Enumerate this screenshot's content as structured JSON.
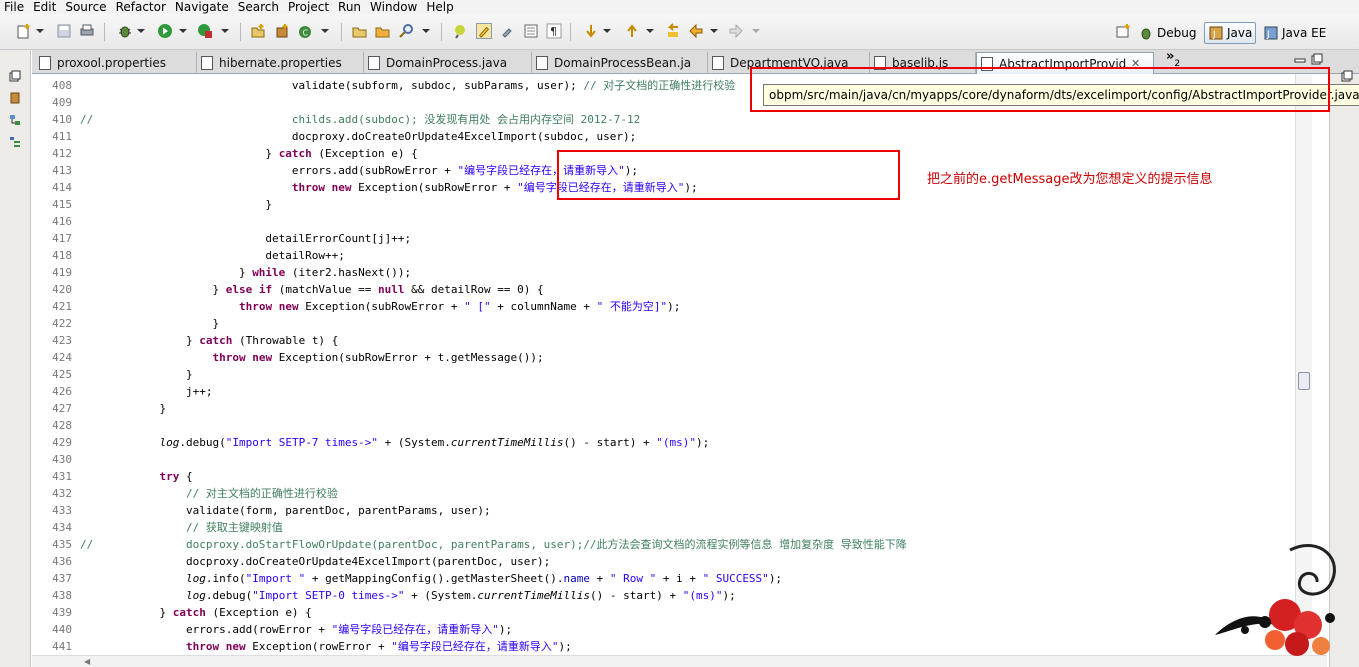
{
  "menu": [
    "File",
    "Edit",
    "Source",
    "Refactor",
    "Navigate",
    "Search",
    "Project",
    "Run",
    "Window",
    "Help"
  ],
  "perspectives": {
    "debug": "Debug",
    "java": "Java",
    "java_ee": "Java EE"
  },
  "tabs": [
    {
      "label": "proxool.properties",
      "icon": "properties-file-icon"
    },
    {
      "label": "hibernate.properties",
      "icon": "properties-file-icon"
    },
    {
      "label": "DomainProcess.java",
      "icon": "java-file-icon"
    },
    {
      "label": "DomainProcessBean.ja",
      "icon": "java-file-icon"
    },
    {
      "label": "DepartmentVO.java",
      "icon": "java-file-icon"
    },
    {
      "label": "baselib.js",
      "icon": "js-file-icon"
    },
    {
      "label": "AbstractImportProvid",
      "icon": "java-file-icon",
      "active": true
    }
  ],
  "tabs_overflow": "»",
  "tabs_overflow_count": "2",
  "tooltip": "obpm/src/main/java/cn/myapps/core/dynaform/dts/excelimport/config/AbstractImportProvider.java",
  "annotation": "把之前的e.getMessage改为您想定义的提示信息",
  "code_lines": [
    {
      "n": "408",
      "t": "                                validate(subform, subdoc, subParams, user); // 对子文档的正确性进行校验"
    },
    {
      "n": "409",
      "t": ""
    },
    {
      "n": "410",
      "t": "//                              childs.add(subdoc); 没发现有用处 会占用内存空间 2012-7-12"
    },
    {
      "n": "411",
      "t": "                                docproxy.doCreateOrUpdate4ExcelImport(subdoc, user);"
    },
    {
      "n": "412",
      "t": "                            } catch (Exception e) {"
    },
    {
      "n": "413",
      "t": "                                errors.add(subRowError + \"编号字段已经存在，请重新导入\");"
    },
    {
      "n": "414",
      "t": "                                throw new Exception(subRowError + \"编号字段已经存在，请重新导入\");"
    },
    {
      "n": "415",
      "t": "                            }"
    },
    {
      "n": "416",
      "t": ""
    },
    {
      "n": "417",
      "t": "                            detailErrorCount[j]++;"
    },
    {
      "n": "418",
      "t": "                            detailRow++;"
    },
    {
      "n": "419",
      "t": "                        } while (iter2.hasNext());"
    },
    {
      "n": "420",
      "t": "                    } else if (matchValue == null && detailRow == 0) {"
    },
    {
      "n": "421",
      "t": "                        throw new Exception(subRowError + \" [\" + columnName + \" 不能为空]\");"
    },
    {
      "n": "422",
      "t": "                    }"
    },
    {
      "n": "423",
      "t": "                } catch (Throwable t) {"
    },
    {
      "n": "424",
      "t": "                    throw new Exception(subRowError + t.getMessage());"
    },
    {
      "n": "425",
      "t": "                }"
    },
    {
      "n": "426",
      "t": "                j++;"
    },
    {
      "n": "427",
      "t": "            }"
    },
    {
      "n": "428",
      "t": ""
    },
    {
      "n": "429",
      "t": "            log.debug(\"Import SETP-7 times->\" + (System.currentTimeMillis() - start) + \"(ms)\");"
    },
    {
      "n": "430",
      "t": ""
    },
    {
      "n": "431",
      "t": "            try {"
    },
    {
      "n": "432",
      "t": "                // 对主文档的正确性进行校验"
    },
    {
      "n": "433",
      "t": "                validate(form, parentDoc, parentParams, user);"
    },
    {
      "n": "434",
      "t": "                // 获取主键映射值"
    },
    {
      "n": "435",
      "t": "//              docproxy.doStartFlowOrUpdate(parentDoc, parentParams, user);//此方法会查询文档的流程实例等信息 增加复杂度 导致性能下降"
    },
    {
      "n": "436",
      "t": "                docproxy.doCreateOrUpdate4ExcelImport(parentDoc, user);"
    },
    {
      "n": "437",
      "t": "                log.info(\"Import \" + getMappingConfig().getMasterSheet().name + \" Row \" + i + \" SUCCESS\");"
    },
    {
      "n": "438",
      "t": "                log.debug(\"Import SETP-0 times->\" + (System.currentTimeMillis() - start) + \"(ms)\");"
    },
    {
      "n": "439",
      "t": "            } catch (Exception e) {"
    },
    {
      "n": "440",
      "t": "                errors.add(rowError + \"编号字段已经存在，请重新导入\");"
    },
    {
      "n": "441",
      "t": "                throw new Exception(rowError + \"编号字段已经存在，请重新导入\");"
    }
  ]
}
